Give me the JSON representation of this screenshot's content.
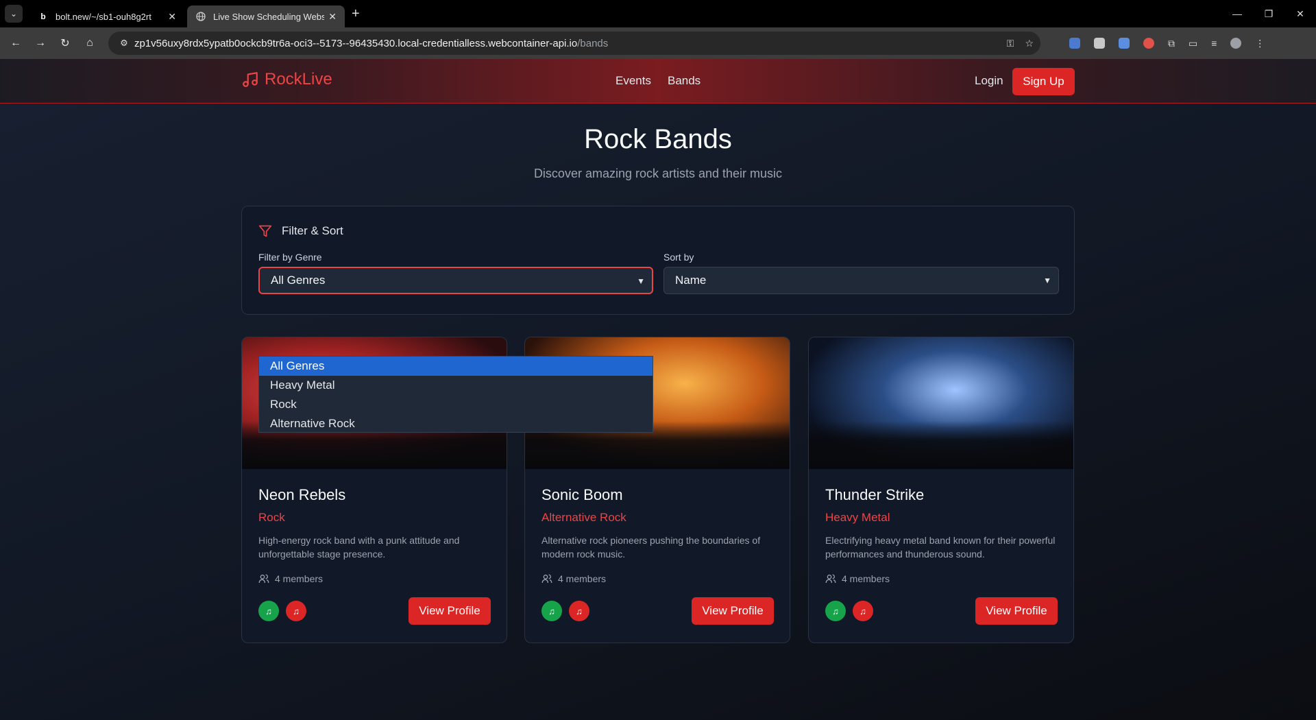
{
  "browser": {
    "tabs": [
      {
        "title": "bolt.new/~/sb1-ouh8g2rt",
        "favicon": "b"
      },
      {
        "title": "Live Show Scheduling Websit",
        "favicon": "globe-icon"
      }
    ],
    "url_host": "zp1v56uxy8rdx5ypatb0ockcb9tr6a-oci3--5173--96435430.local-credentialless.webcontainer-api.io",
    "url_path": "/bands"
  },
  "header": {
    "brand": "RockLive",
    "nav": [
      "Events",
      "Bands"
    ],
    "login": "Login",
    "signup": "Sign Up"
  },
  "page": {
    "title": "Rock Bands",
    "subtitle": "Discover amazing rock artists and their music"
  },
  "filters": {
    "heading": "Filter & Sort",
    "genre_label": "Filter by Genre",
    "genre_value": "All Genres",
    "genre_options": [
      "All Genres",
      "Heavy Metal",
      "Rock",
      "Alternative Rock"
    ],
    "sort_label": "Sort by",
    "sort_value": "Name"
  },
  "bands": [
    {
      "name": "Neon Rebels",
      "genre": "Rock",
      "description": "High-energy rock band with a punk attitude and unforgettable stage presence.",
      "members": "4 members",
      "button": "View Profile"
    },
    {
      "name": "Sonic Boom",
      "genre": "Alternative Rock",
      "description": "Alternative rock pioneers pushing the boundaries of modern rock music.",
      "members": "4 members",
      "button": "View Profile"
    },
    {
      "name": "Thunder Strike",
      "genre": "Heavy Metal",
      "description": "Electrifying heavy metal band known for their powerful performances and thunderous sound.",
      "members": "4 members",
      "button": "View Profile"
    }
  ],
  "colors": {
    "accent": "#dc2626",
    "green": "#16a34a",
    "selected_option": "#1f66d1"
  }
}
